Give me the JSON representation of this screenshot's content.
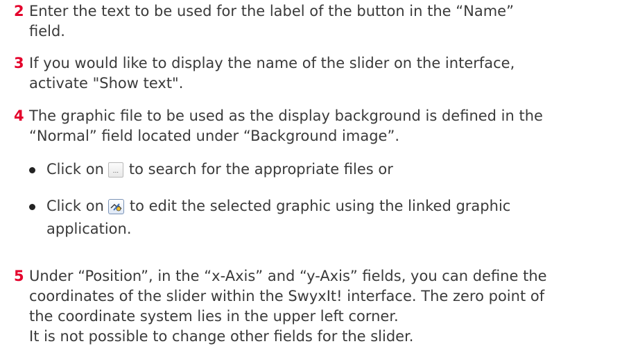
{
  "steps": [
    {
      "number": "2",
      "lines": [
        "Enter the text to be used for the label of the button in the “Name”",
        "field."
      ]
    },
    {
      "number": "3",
      "lines": [
        "If you would like to display the name of the slider on the interface,",
        "activate \"Show text\"."
      ]
    },
    {
      "number": "4",
      "lines": [
        "The graphic file to be used as the display background is defined in the",
        "“Normal” field located under “Background image”."
      ]
    },
    {
      "number": "5",
      "lines": [
        "Under “Position”, in the “x-Axis” and “y-Axis” fields, you can define the",
        "coordinates of the slider within the SwyxIt! interface. The zero point of",
        "the coordinate system lies in the upper left corner.",
        "It is not possible to change other fields for the slider."
      ]
    }
  ],
  "bullets": [
    {
      "before": "Click on",
      "after": "to search for the appropriate files or",
      "icon": "browse-button-icon",
      "icon_label": "..."
    },
    {
      "before": "Click on",
      "after": "to edit the selected graphic using the linked graphic",
      "after_line2": "application.",
      "icon": "edit-graphic-icon"
    }
  ],
  "colors": {
    "step_number": "#e4002b",
    "text": "#3a3a3a"
  }
}
